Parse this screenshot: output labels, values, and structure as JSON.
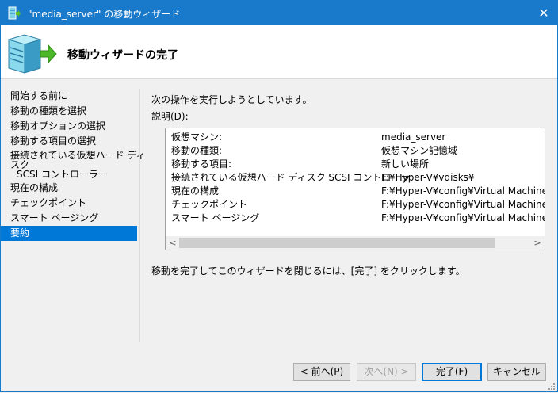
{
  "window": {
    "title": "\"media_server\" の移動ウィザード",
    "close_glyph": "✕",
    "accent": "#1979ca"
  },
  "header": {
    "title": "移動ウィザードの完了",
    "icon": "server-move-icon"
  },
  "nav": {
    "items": [
      {
        "label": "開始する前に"
      },
      {
        "label": "移動の種類を選択"
      },
      {
        "label": "移動オプションの選択"
      },
      {
        "label": "移動する項目の選択"
      },
      {
        "label_lines": [
          "接続されている仮想ハード ディ",
          "スク",
          "SCSI コントローラー"
        ]
      },
      {
        "label": "現在の構成"
      },
      {
        "label": "チェックポイント"
      },
      {
        "label": "スマート ページング"
      },
      {
        "label": "要約"
      }
    ],
    "selected_index": 8,
    "selected_color": "#0078d7"
  },
  "main": {
    "intro": "次の操作を実行しようとしています。",
    "desc_label": "説明(D):",
    "rows": [
      {
        "key": "仮想マシン:",
        "value": "media_server"
      },
      {
        "key": "移動の種類:",
        "value": "仮想マシン記憶域"
      },
      {
        "key": "移動する項目:",
        "value": "新しい場所"
      },
      {
        "key": "接続されている仮想ハード ディスク SCSI コントローラー",
        "value": "F:¥Hyper-V¥vdisks¥"
      },
      {
        "key": "現在の構成",
        "value": "F:¥Hyper-V¥config¥Virtual Machines¥media"
      },
      {
        "key": "チェックポイント",
        "value": "F:¥Hyper-V¥config¥Virtual Machines¥media"
      },
      {
        "key": "スマート ページング",
        "value": "F:¥Hyper-V¥config¥Virtual Machines¥media"
      }
    ],
    "scroll_left": "<",
    "scroll_right": ">",
    "finish_note": "移動を完了してこのウィザードを閉じるには、[完了] をクリックします。"
  },
  "buttons": {
    "back": "< 前へ(P)",
    "next": "次へ(N) >",
    "finish": "完了(F)",
    "cancel": "キャンセル"
  }
}
